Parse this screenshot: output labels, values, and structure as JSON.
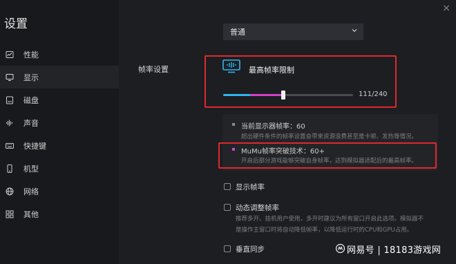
{
  "app": {
    "title": "设置"
  },
  "sidebar": {
    "items": [
      {
        "label": "性能",
        "icon": "performance-icon"
      },
      {
        "label": "显示",
        "icon": "monitor-icon",
        "active": true
      },
      {
        "label": "磁盘",
        "icon": "disk-icon"
      },
      {
        "label": "声音",
        "icon": "sound-icon"
      },
      {
        "label": "快捷键",
        "icon": "keyboard-icon"
      },
      {
        "label": "机型",
        "icon": "phone-icon"
      },
      {
        "label": "网络",
        "icon": "globe-icon"
      },
      {
        "label": "其他",
        "icon": "grid-icon"
      }
    ]
  },
  "display": {
    "quality_select": {
      "value": "普通"
    },
    "frame_rate": {
      "section_label": "帧率设置",
      "limit_title": "最高帧率限制",
      "slider": {
        "value": 111,
        "max": 240,
        "display": "111/240"
      }
    },
    "info": {
      "current_fps": {
        "title": "当前显示器帧率：60",
        "desc": "超出硬件条件的帧率设置会带来资源浪费甚至是卡顿、发热等情况。"
      },
      "mumu_boost": {
        "title": "MuMu帧率突破技术：60+",
        "desc": "开启后部分游戏能够突破自身帧率，达到模拟器适配后的最高帧率。"
      }
    },
    "options": {
      "show_fps": {
        "label": "显示帧率",
        "checked": false
      },
      "dynamic_fps": {
        "label": "动态调整帧率",
        "checked": false,
        "desc_line1": "推荐多开、挂机用户使用，多开时建议为所有窗口开启此选项。模拟器不",
        "desc_line2": "是操作主窗口时将自动降低帧率，以降低运行时的CPU和GPU占用。"
      },
      "vsync": {
        "label": "垂直同步",
        "checked": false
      }
    }
  },
  "watermark": {
    "text": "网易号 | 18183游戏网"
  },
  "colors": {
    "accent_blue": "#2fb6f2",
    "accent_pink": "#d541c6",
    "highlight_red": "#e0282a",
    "bullet_gray": "#8a8a8e",
    "bullet_purple": "#c64ad6"
  }
}
